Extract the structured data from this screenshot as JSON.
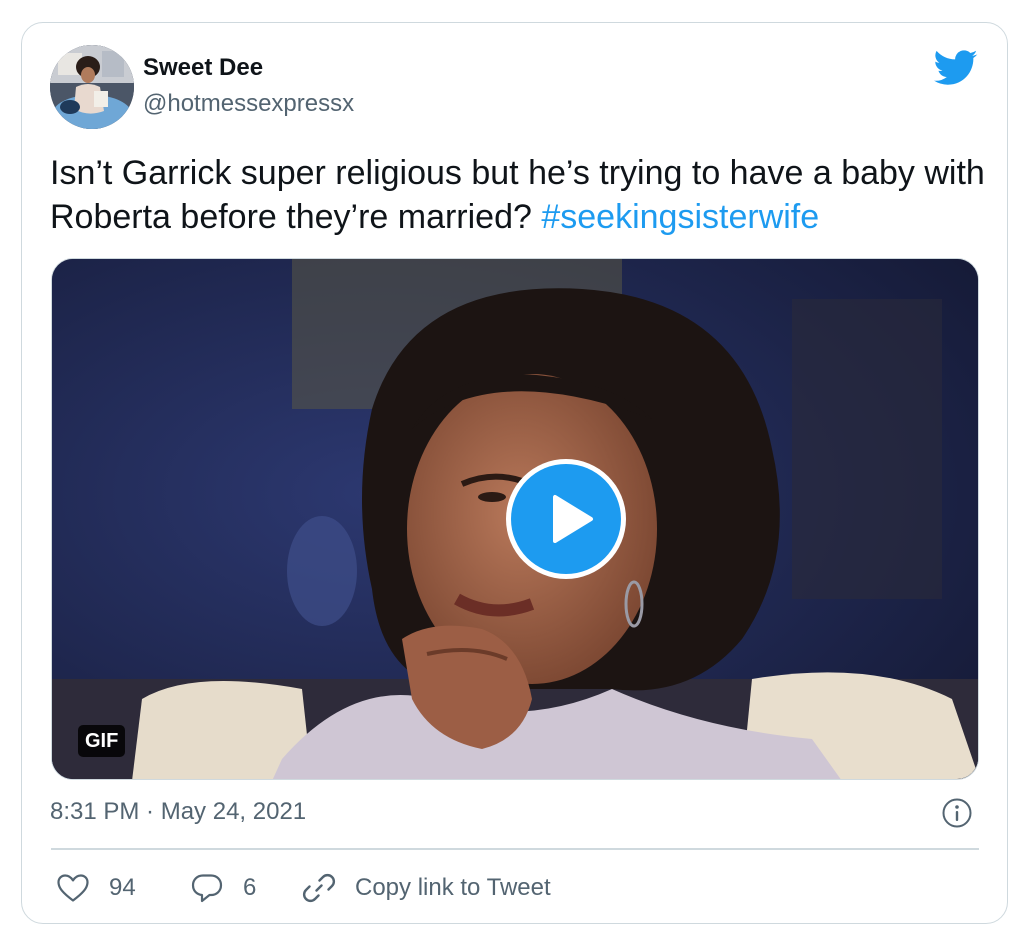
{
  "tweet": {
    "author": {
      "display_name": "Sweet Dee",
      "handle": "@hotmessexpressx"
    },
    "text_main": "Isn’t Garrick super religious but he’s trying to have a baby with Roberta before they’re married? ",
    "hashtag": "#seekingsisterwife",
    "media": {
      "type_badge": "GIF"
    },
    "timestamp": "8:31 PM · May 24, 2021",
    "actions": {
      "like_count": "94",
      "reply_count": "6",
      "copy_link_label": "Copy link to Tweet"
    }
  },
  "icons": {
    "brand": "twitter-bird-icon",
    "play": "play-icon",
    "info": "info-icon",
    "like": "heart-icon",
    "reply": "reply-icon",
    "link": "link-icon"
  },
  "colors": {
    "accent": "#1d9bf0",
    "text_primary": "#0f1419",
    "text_secondary": "#536471",
    "border": "#cfd9de"
  }
}
